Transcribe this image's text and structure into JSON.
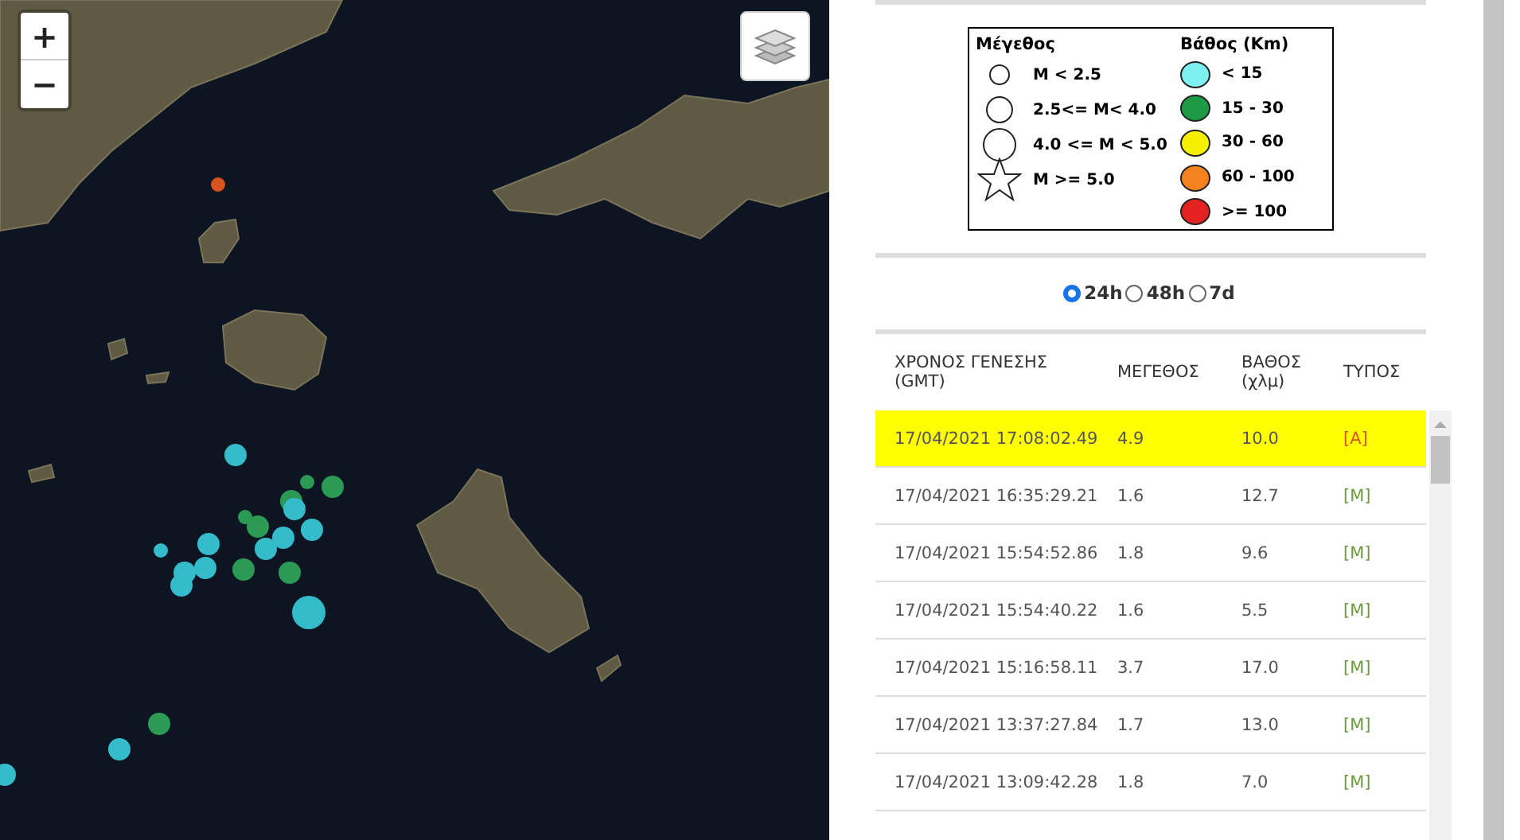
{
  "map": {
    "zoom_in": "+",
    "zoom_out": "−",
    "markers": [
      {
        "kind": "small",
        "color": "#d9531e"
      },
      {
        "kind": "medium",
        "color": "#35bccb"
      },
      {
        "kind": "small",
        "color": "#2a9a55"
      },
      {
        "kind": "medium",
        "color": "#2a9a55"
      },
      {
        "kind": "medium",
        "color": "#2a9a55"
      },
      {
        "kind": "medium",
        "color": "#35bccb"
      },
      {
        "kind": "small",
        "color": "#2a9a55"
      },
      {
        "kind": "medium",
        "color": "#2a9a55"
      },
      {
        "kind": "medium",
        "color": "#35bccb"
      },
      {
        "kind": "medium",
        "color": "#35bccb"
      },
      {
        "kind": "medium",
        "color": "#35bccb"
      },
      {
        "kind": "small",
        "color": "#35bccb"
      },
      {
        "kind": "medium",
        "color": "#35bccb"
      },
      {
        "kind": "medium",
        "color": "#35bccb"
      },
      {
        "kind": "medium",
        "color": "#35bccb"
      },
      {
        "kind": "medium",
        "color": "#2a9a55"
      },
      {
        "kind": "medium",
        "color": "#2a9a55"
      },
      {
        "kind": "medium",
        "color": "#35bccb"
      },
      {
        "kind": "large",
        "color": "#35bccb"
      },
      {
        "kind": "medium",
        "color": "#2a9a55"
      },
      {
        "kind": "medium",
        "color": "#35bccb"
      },
      {
        "kind": "medium",
        "color": "#35bccb"
      }
    ]
  },
  "legend": {
    "magnitude_title": "Μέγεθος",
    "magnitude_items": [
      {
        "kind": "small",
        "label": "M < 2.5"
      },
      {
        "kind": "medium",
        "label": "2.5<= M< 4.0"
      },
      {
        "kind": "large",
        "label": "4.0 <= M < 5.0"
      },
      {
        "kind": "star",
        "label": "M >= 5.0"
      }
    ],
    "depth_title": "Βάθος (Km)",
    "depth_items": [
      {
        "color": "#7ff0f0",
        "label": "< 15"
      },
      {
        "color": "#1e9a45",
        "label": "15 - 30"
      },
      {
        "color": "#f5f000",
        "label": "30 - 60"
      },
      {
        "color": "#f5821f",
        "label": "60 - 100"
      },
      {
        "color": "#e52222",
        "label": ">= 100"
      }
    ]
  },
  "periods": [
    {
      "label": "24h",
      "selected": true
    },
    {
      "label": "48h",
      "selected": false
    },
    {
      "label": "7d",
      "selected": false
    }
  ],
  "table": {
    "columns": [
      "ΧΡΟΝΟΣ ΓΕΝΕΣΗΣ (GMT)",
      "ΜΕΓΕΘΟΣ",
      "ΒΑΘΟΣ (χλμ)",
      "ΤΥΠΟΣ"
    ],
    "rows": [
      {
        "time": "17/04/2021 17:08:02.49",
        "magnitude": "4.9",
        "depth": "10.0",
        "type": "[A]",
        "color": "#d9531e",
        "selected": true
      },
      {
        "time": "17/04/2021 16:35:29.21",
        "magnitude": "1.6",
        "depth": "12.7",
        "type": "[M]",
        "color": "#6e9a3e",
        "selected": false
      },
      {
        "time": "17/04/2021 15:54:52.86",
        "magnitude": "1.8",
        "depth": "9.6",
        "type": "[M]",
        "color": "#6e9a3e",
        "selected": false
      },
      {
        "time": "17/04/2021 15:54:40.22",
        "magnitude": "1.6",
        "depth": "5.5",
        "type": "[M]",
        "color": "#6e9a3e",
        "selected": false
      },
      {
        "time": "17/04/2021 15:16:58.11",
        "magnitude": "3.7",
        "depth": "17.0",
        "type": "[M]",
        "color": "#6e9a3e",
        "selected": false
      },
      {
        "time": "17/04/2021 13:37:27.84",
        "magnitude": "1.7",
        "depth": "13.0",
        "type": "[M]",
        "color": "#6e9a3e",
        "selected": false
      },
      {
        "time": "17/04/2021 13:09:42.28",
        "magnitude": "1.8",
        "depth": "7.0",
        "type": "[M]",
        "color": "#6e9a3e",
        "selected": false
      }
    ]
  }
}
